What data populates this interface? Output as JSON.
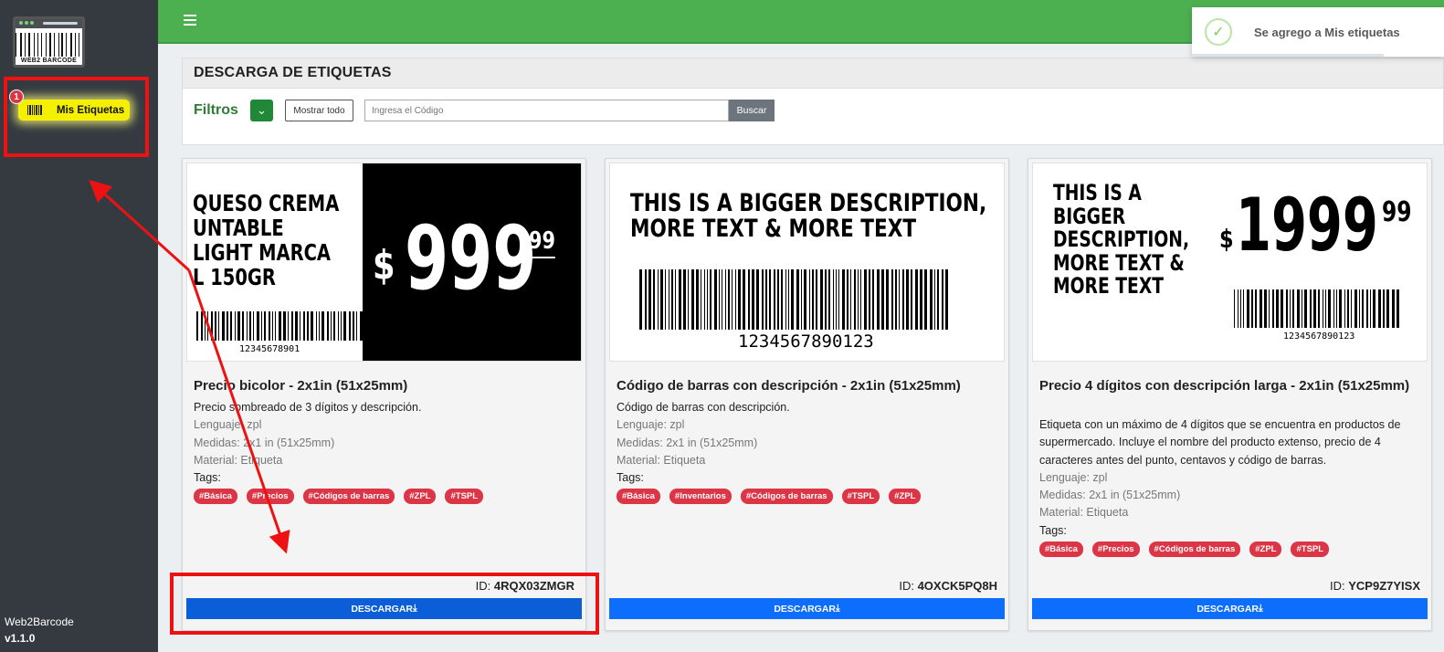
{
  "sidebar": {
    "logo_text": "WEB2 BARCODE",
    "badge": "1",
    "nav_item": "Mis Etiquetas",
    "app_name": "Web2Barcode",
    "version": "v1.1.0"
  },
  "toast": {
    "message": "Se agrego a Mis etiquetas",
    "icon": "check-icon"
  },
  "header": {
    "title": "DESCARGA DE ETIQUETAS"
  },
  "filters": {
    "label": "Filtros",
    "show_all": "Mostrar todo",
    "search_placeholder": "Ingresa el Código",
    "search_button": "Buscar"
  },
  "cards": [
    {
      "title": "Precio bicolor - 2x1in (51x25mm)",
      "description": "Precio sombreado de 3 dígitos y descripción.",
      "language": "Lenguaje: zpl",
      "size": "Medidas: 2x1 in (51x25mm)",
      "material": "Material: Etiqueta",
      "tags_label": "Tags:",
      "tags": [
        "#Básica",
        "#Precios",
        "#Códigos de barras",
        "#ZPL",
        "#TSPL"
      ],
      "id_label": "ID:",
      "id": "4RQX03ZMGR",
      "download": "DESCARGAR",
      "label_preview": {
        "text_lines": [
          "QUESO CREMA",
          "UNTABLE",
          "LIGHT MARCA",
          "L 150GR"
        ],
        "currency": "$",
        "price": "999",
        "cents": "99",
        "barcode_number": "12345678901"
      }
    },
    {
      "title": "Código de barras con descripción - 2x1in (51x25mm)",
      "description": "Código de barras con descripción.",
      "language": "Lenguaje: zpl",
      "size": "Medidas: 2x1 in (51x25mm)",
      "material": "Material: Etiqueta",
      "tags_label": "Tags:",
      "tags": [
        "#Básica",
        "#Inventarios",
        "#Códigos de barras",
        "#TSPL",
        "#ZPL"
      ],
      "id_label": "ID:",
      "id": "4OXCK5PQ8H",
      "download": "DESCARGAR",
      "label_preview": {
        "text_lines": [
          "THIS IS A BIGGER DESCRIPTION,",
          "MORE TEXT & MORE TEXT"
        ],
        "barcode_number": "1234567890123"
      }
    },
    {
      "title": "Precio 4 dígitos con descripción larga - 2x1in (51x25mm)",
      "description": "Etiqueta con un máximo de 4 dígitos que se encuentra en productos de supermercado. Incluye el nombre del producto extenso, precio de 4 caracteres antes del punto, centavos y código de barras.",
      "language": "Lenguaje: zpl",
      "size": "Medidas: 2x1 in (51x25mm)",
      "material": "Material: Etiqueta",
      "tags_label": "Tags:",
      "tags": [
        "#Básica",
        "#Precios",
        "#Códigos de barras",
        "#ZPL",
        "#TSPL"
      ],
      "id_label": "ID:",
      "id": "YCP9Z7YISX",
      "download": "DESCARGAR",
      "label_preview": {
        "text_lines": [
          "THIS IS A",
          "BIGGER",
          "DESCRIPTION,",
          "MORE TEXT &",
          "MORE TEXT"
        ],
        "currency": "$",
        "price": "1999",
        "cents": "99",
        "barcode_number": "1234567890123"
      }
    }
  ],
  "colors": {
    "sidebar": "#343a40",
    "topbar": "#4caf50",
    "download": "#0d6efd",
    "tag": "#dc3545",
    "highlight": "#f5f000",
    "annotation": "#ee1111"
  }
}
